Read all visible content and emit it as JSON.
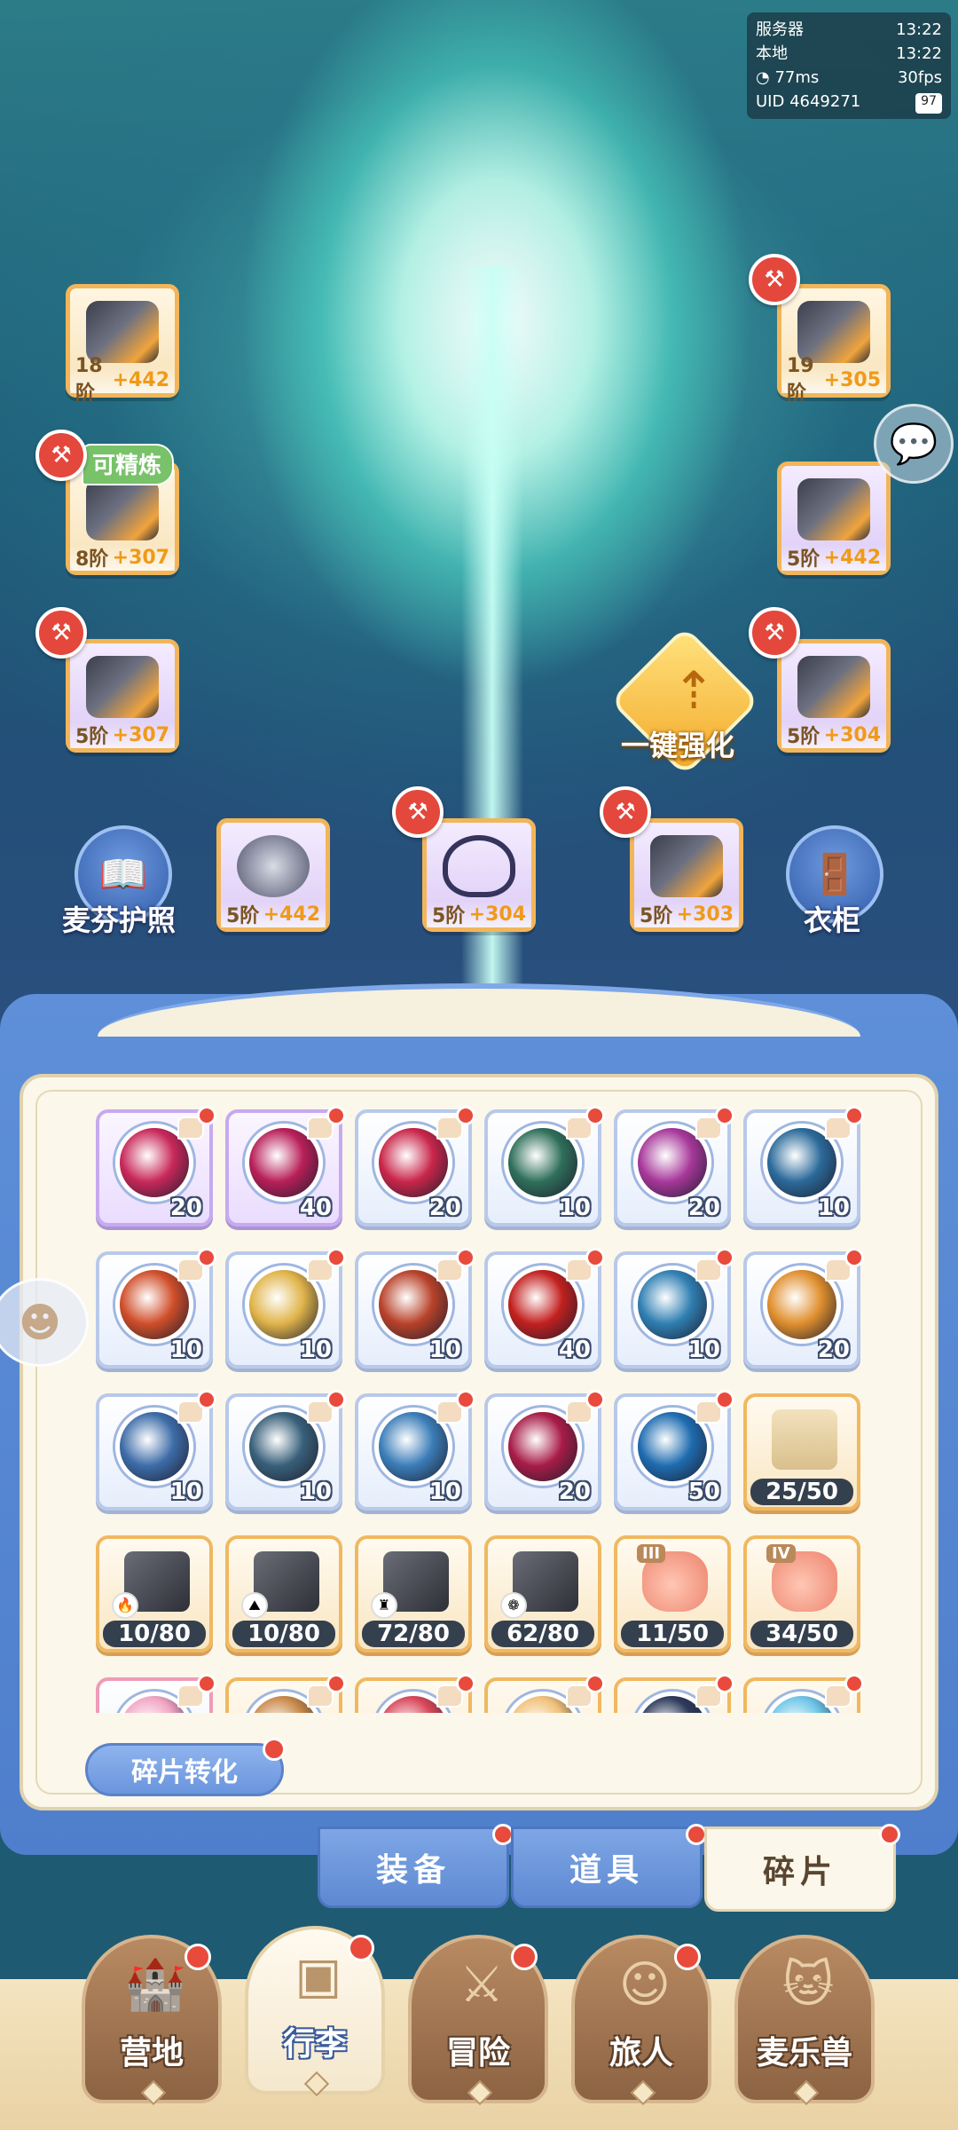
{
  "hud": {
    "server_label": "服务器",
    "server_time": "13:22",
    "local_label": "本地",
    "local_time": "13:22",
    "ping": "77ms",
    "fps": "30fps",
    "uid_label": "UID",
    "uid": "4649271",
    "battery": "97"
  },
  "equipment": {
    "bow": {
      "tier": "18阶",
      "plus": "+442"
    },
    "helmet": {
      "tier": "19阶",
      "plus": "+305"
    },
    "chest": {
      "tier": "8阶",
      "plus": "+307",
      "badge": "可精炼"
    },
    "gauntlet": {
      "tier": "5阶",
      "plus": "+442"
    },
    "pants": {
      "tier": "5阶",
      "plus": "+307"
    },
    "boots": {
      "tier": "5阶",
      "plus": "+304"
    },
    "ring": {
      "tier": "5阶",
      "plus": "+442"
    },
    "necklace": {
      "tier": "5阶",
      "plus": "+304"
    },
    "charm": {
      "tier": "5阶",
      "plus": "+303"
    }
  },
  "actions": {
    "passport_label": "麦芬护照",
    "wardrobe_label": "衣柜",
    "enhance_all_label": "一键强化",
    "convert_label": "碎片转化"
  },
  "icons": {
    "hammer": "hammer-icon",
    "chat": "chat-bubble-icon",
    "passport": "passport-book-icon",
    "wardrobe": "wardrobe-icon",
    "enhance": "enhance-arrow-icon",
    "companion": "pet-face-icon"
  },
  "fragments": {
    "rows": [
      [
        {
          "count": "20",
          "style": "purple",
          "color": "#c8285a"
        },
        {
          "count": "40",
          "style": "purple",
          "color": "#b81f58"
        },
        {
          "count": "20",
          "style": "blue",
          "color": "#c9264a"
        },
        {
          "count": "10",
          "style": "blue",
          "color": "#2f6f5a"
        },
        {
          "count": "20",
          "style": "blue",
          "color": "#a7389a"
        },
        {
          "count": "10",
          "style": "blue",
          "color": "#2b6a9a"
        }
      ],
      [
        {
          "count": "10",
          "style": "blue",
          "color": "#d04e2a"
        },
        {
          "count": "10",
          "style": "blue",
          "color": "#e0b44a"
        },
        {
          "count": "10",
          "style": "blue",
          "color": "#b8422a"
        },
        {
          "count": "40",
          "style": "blue",
          "color": "#c2201e"
        },
        {
          "count": "10",
          "style": "blue",
          "color": "#2f7fb2"
        },
        {
          "count": "20",
          "style": "blue",
          "color": "#e08f2e"
        }
      ],
      [
        {
          "count": "10",
          "style": "blue",
          "color": "#3d6ca8"
        },
        {
          "count": "10",
          "style": "blue",
          "color": "#38607a"
        },
        {
          "count": "10",
          "style": "blue",
          "color": "#3b7db8"
        },
        {
          "count": "20",
          "style": "blue",
          "color": "#a81c48"
        },
        {
          "count": "50",
          "style": "blue",
          "color": "#1e6cb0"
        },
        {
          "count": "25/50",
          "style": "gold",
          "kind": "scroll"
        }
      ],
      [
        {
          "count": "10/80",
          "style": "gold",
          "kind": "armor",
          "elem": "🔥"
        },
        {
          "count": "10/80",
          "style": "gold",
          "kind": "armor",
          "elem": "⛰"
        },
        {
          "count": "72/80",
          "style": "gold",
          "kind": "armor",
          "elem": "♜"
        },
        {
          "count": "62/80",
          "style": "gold",
          "kind": "armor",
          "elem": "❁"
        },
        {
          "count": "11/50",
          "style": "gold",
          "kind": "fist",
          "roman": "III"
        },
        {
          "count": "34/50",
          "style": "gold",
          "kind": "fist",
          "roman": "IV"
        }
      ],
      [
        {
          "count": "",
          "style": "pink",
          "color": "#f2a6c4"
        },
        {
          "count": "",
          "style": "gold",
          "color": "#c98a4a"
        },
        {
          "count": "",
          "style": "gold",
          "color": "#d8485a"
        },
        {
          "count": "",
          "style": "gold",
          "color": "#f0c27a"
        },
        {
          "count": "",
          "style": "gold",
          "color": "#2d3a5a"
        },
        {
          "count": "",
          "style": "gold",
          "color": "#6ec6e8"
        }
      ]
    ]
  },
  "tabs": [
    {
      "label": "装备",
      "active": false
    },
    {
      "label": "道具",
      "active": false
    },
    {
      "label": "碎片",
      "active": true
    }
  ],
  "nav": [
    {
      "label": "营地",
      "icon": "castle-icon",
      "glyph": "🏰"
    },
    {
      "label": "行李",
      "icon": "chest-icon",
      "glyph": "▣"
    },
    {
      "label": "冒险",
      "icon": "crossed-swords-icon",
      "glyph": "⚔"
    },
    {
      "label": "旅人",
      "icon": "character-icon",
      "glyph": "☺"
    },
    {
      "label": "麦乐兽",
      "icon": "cat-pet-icon",
      "glyph": "🐱"
    }
  ],
  "colors": {
    "accent_blue": "#5e89d2",
    "badge_red": "#e84a3c",
    "panel_cream": "#fbf7ea",
    "plus_orange": "#f09a18"
  }
}
